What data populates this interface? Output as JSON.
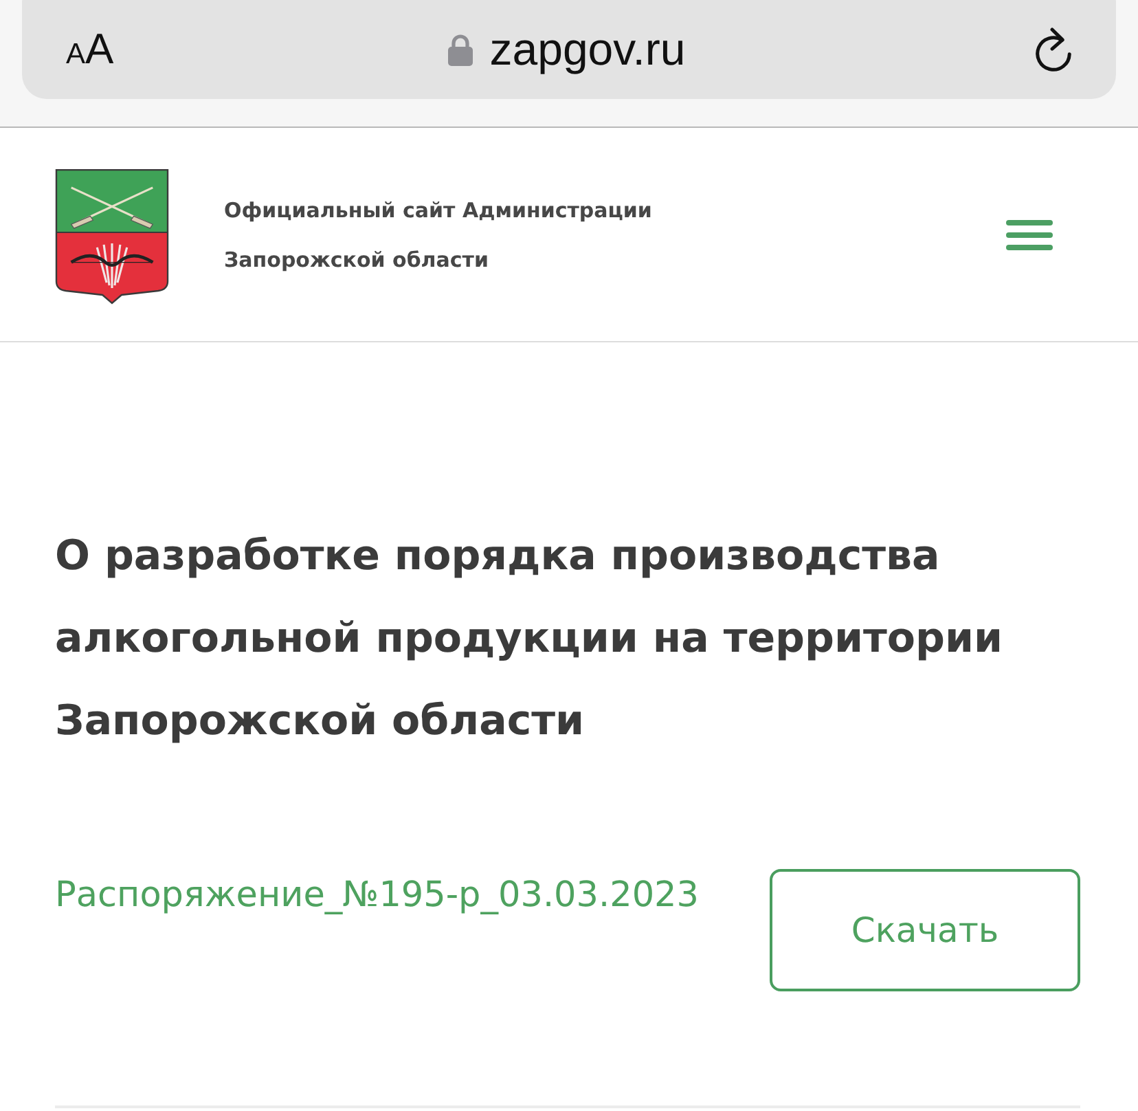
{
  "browser_bar": {
    "text_size_button": {
      "small": "A",
      "large": "A"
    },
    "secure": true,
    "url": "zapgov.ru"
  },
  "header": {
    "site_title": [
      "Официальный сайт Администрации",
      "Запорожской области"
    ]
  },
  "article": {
    "title": "О разработке порядка производства алкогольной продукции на территории Запорожской области",
    "documents": [
      {
        "name": "Распоряжение_№195-р_03.03.2023",
        "button": "Скачать"
      }
    ]
  }
}
